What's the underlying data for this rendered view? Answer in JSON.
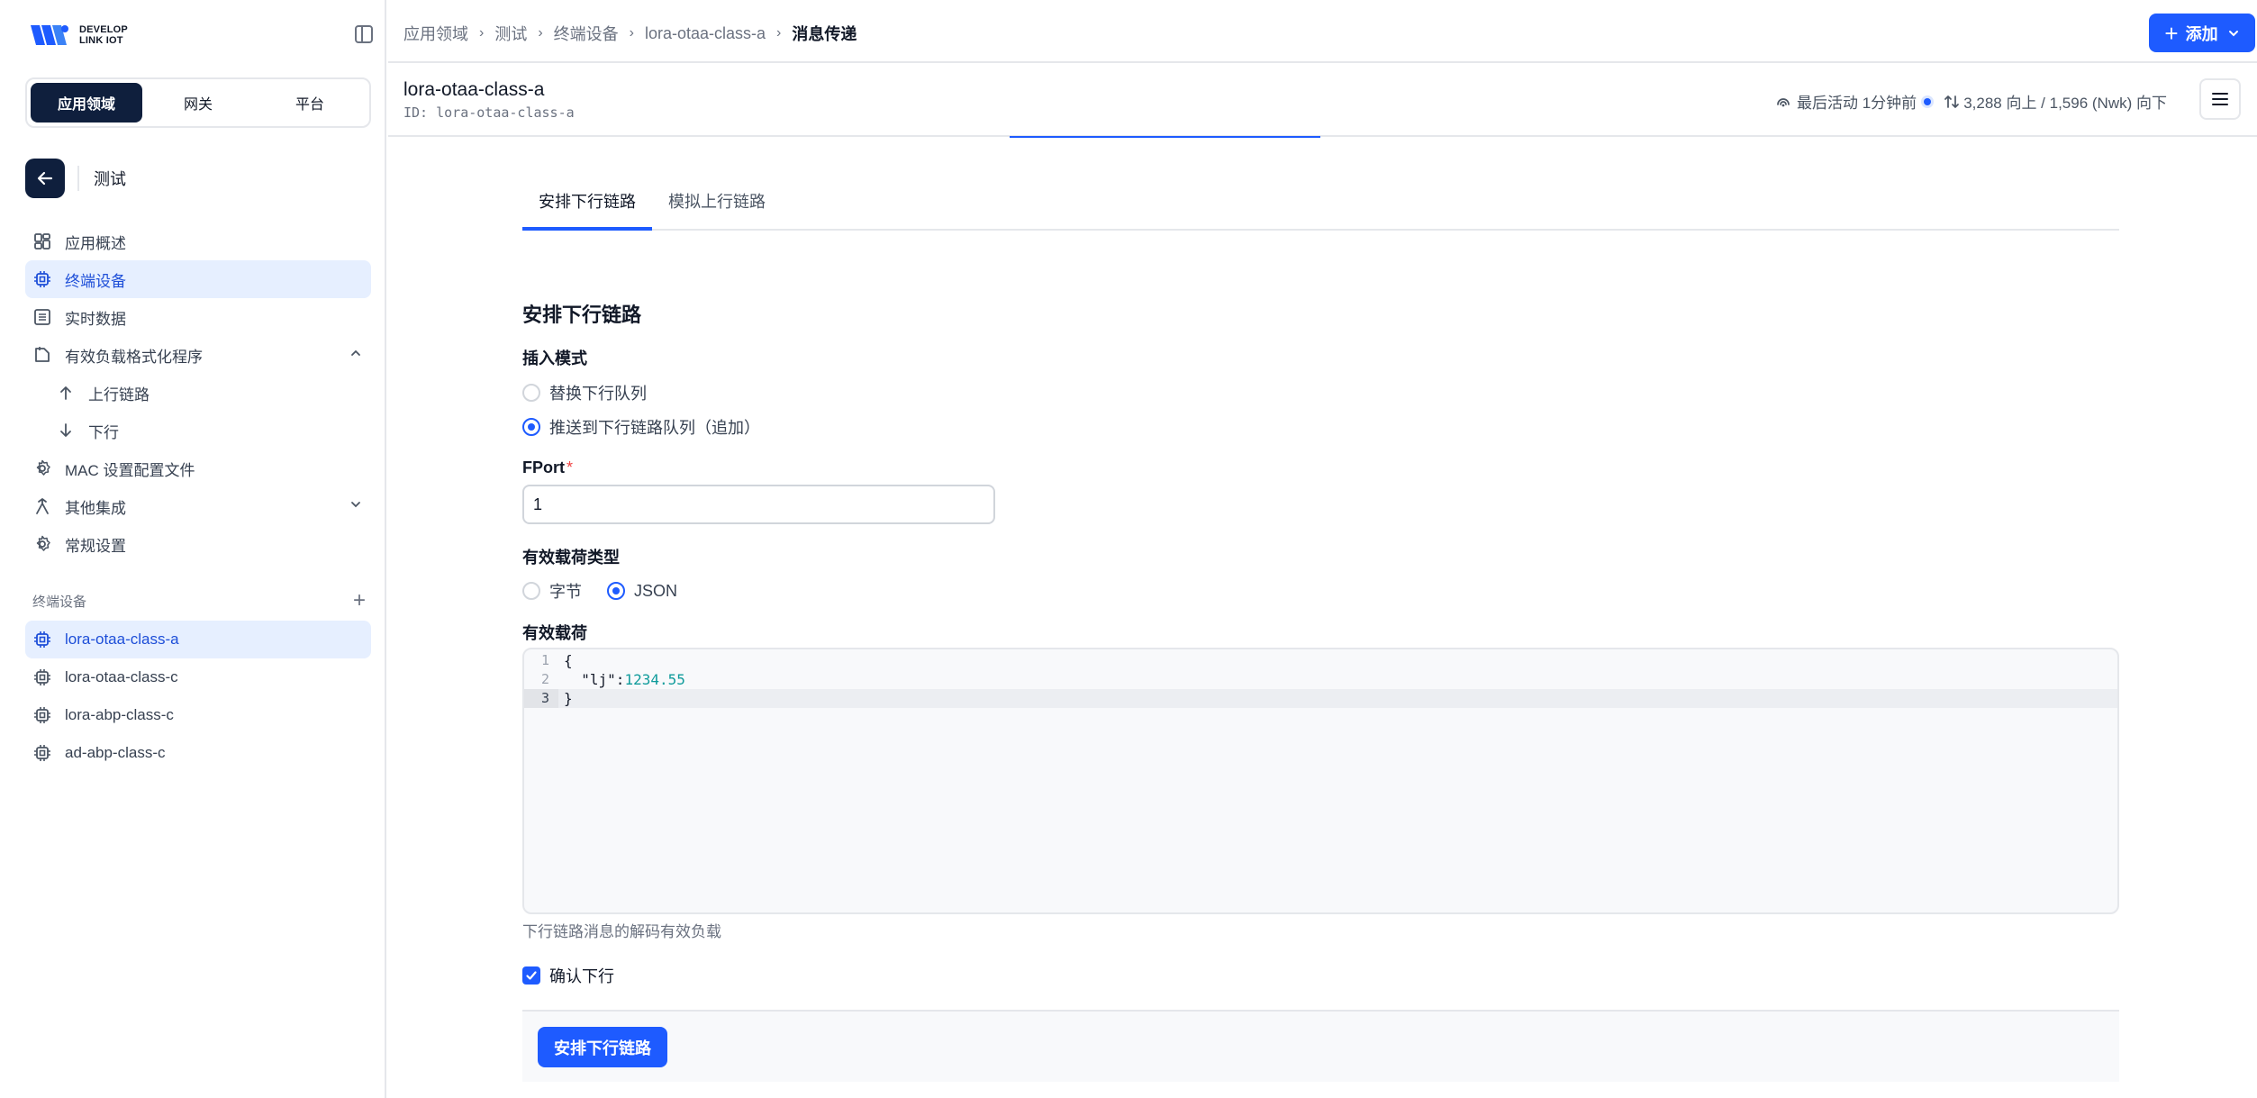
{
  "brand": {
    "line1": "DEVELOP",
    "line2": "LINK IOT"
  },
  "sidebar": {
    "segments": [
      "应用领域",
      "网关",
      "平台"
    ],
    "back_title": "测试",
    "nav": [
      {
        "label": "应用概述",
        "icon": "dashboard-icon"
      },
      {
        "label": "终端设备",
        "icon": "chip-icon",
        "active": true
      },
      {
        "label": "实时数据",
        "icon": "list-icon"
      },
      {
        "label": "有效负载格式化程序",
        "icon": "code-file-icon"
      },
      {
        "label": "上行链路",
        "icon": "arrow-up-icon"
      },
      {
        "label": "下行",
        "icon": "arrow-down-icon"
      },
      {
        "label": "MAC 设置配置文件",
        "icon": "gear-icon"
      },
      {
        "label": "其他集成",
        "icon": "integration-icon"
      },
      {
        "label": "常规设置",
        "icon": "gear-icon"
      }
    ],
    "devices_heading": "终端设备",
    "devices": [
      "lora-otaa-class-a",
      "lora-otaa-class-c",
      "lora-abp-class-c",
      "ad-abp-class-c"
    ]
  },
  "breadcrumb": [
    "应用领域",
    "测试",
    "终端设备",
    "lora-otaa-class-a",
    "消息传递"
  ],
  "add_button": "添加",
  "device": {
    "name": "lora-otaa-class-a",
    "id_line": "ID: lora-otaa-class-a",
    "activity": "最后活动 1分钟前",
    "traffic": "3,288 向上 / 1,596 (Nwk) 向下"
  },
  "tabs": [
    "安排下行链路",
    "模拟上行链路"
  ],
  "form": {
    "title": "安排下行链路",
    "insert_mode_label": "插入模式",
    "insert_modes": [
      "替换下行队列",
      "推送到下行链路队列（追加）"
    ],
    "insert_mode_selected": 1,
    "fport_label": "FPort",
    "fport_required": "*",
    "fport_value": "1",
    "payload_type_label": "有效载荷类型",
    "payload_types": [
      "字节",
      "JSON"
    ],
    "payload_type_selected": 1,
    "payload_label": "有效载荷",
    "code_lines": [
      "{",
      "  \"lj\":1234.55",
      "}"
    ],
    "line_numbers": [
      "1",
      "2",
      "3"
    ],
    "payload_hint": "下行链路消息的解码有效负载",
    "confirm_label": "确认下行",
    "confirm_checked": true,
    "submit_label": "安排下行链路"
  },
  "colors": {
    "primary": "#1e5bff",
    "navy": "#0f1f3d",
    "active_bg": "#e6efff"
  }
}
